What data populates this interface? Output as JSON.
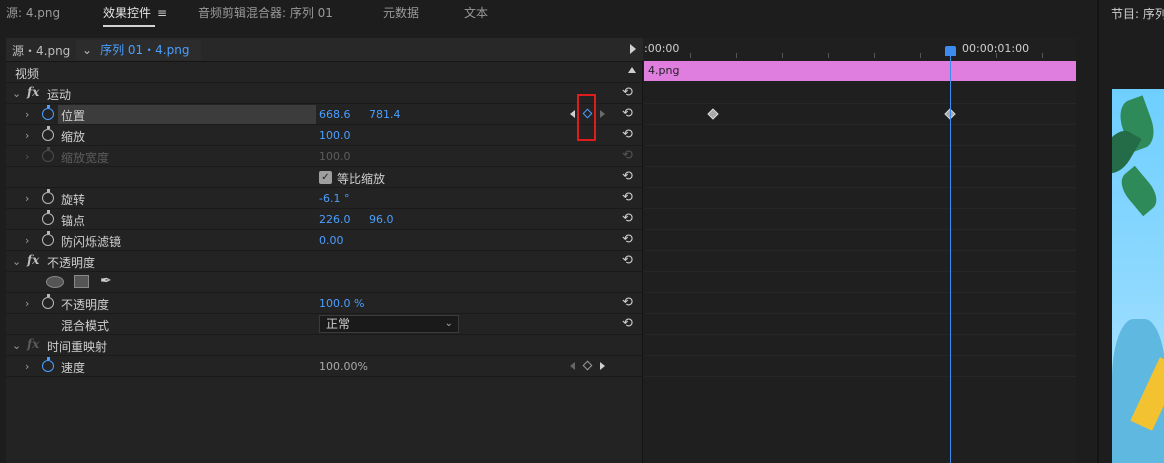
{
  "tabs": [
    {
      "label": "源: 4.png",
      "active": false
    },
    {
      "label": "效果控件",
      "active": true
    },
    {
      "label": "音频剪辑混合器: 序列 01",
      "active": false
    },
    {
      "label": "元数据",
      "active": false
    },
    {
      "label": "文本",
      "active": false
    }
  ],
  "source_bar": {
    "source": "源・4.png",
    "sequence": "序列 01・4.png"
  },
  "section_video": "视频",
  "motion": {
    "label": "运动",
    "position": {
      "label": "位置",
      "x": "668.6",
      "y": "781.4"
    },
    "scale": {
      "label": "缩放",
      "value": "100.0"
    },
    "scale_width": {
      "label": "缩放宽度",
      "value": "100.0"
    },
    "uniform_scale": {
      "label": "等比缩放"
    },
    "rotation": {
      "label": "旋转",
      "value": "-6.1 °"
    },
    "anchor": {
      "label": "锚点",
      "x": "226.0",
      "y": "96.0"
    },
    "antiflicker": {
      "label": "防闪烁滤镜",
      "value": "0.00"
    }
  },
  "opacity": {
    "label": "不透明度",
    "opacity_param": {
      "label": "不透明度",
      "value": "100.0 %"
    },
    "blend": {
      "label": "混合模式",
      "value": "正常"
    }
  },
  "time_remap": {
    "label": "时间重映射",
    "speed": {
      "label": "速度",
      "value": "100.00%"
    }
  },
  "timeline": {
    "start": ":00:00",
    "mark": "00:00:01:00",
    "clip": "4.png"
  },
  "program": {
    "title": "节目: 序列"
  },
  "colors": {
    "accent": "#4a9fff",
    "clip": "#e07ee0",
    "highlight": "#e01b1b"
  }
}
